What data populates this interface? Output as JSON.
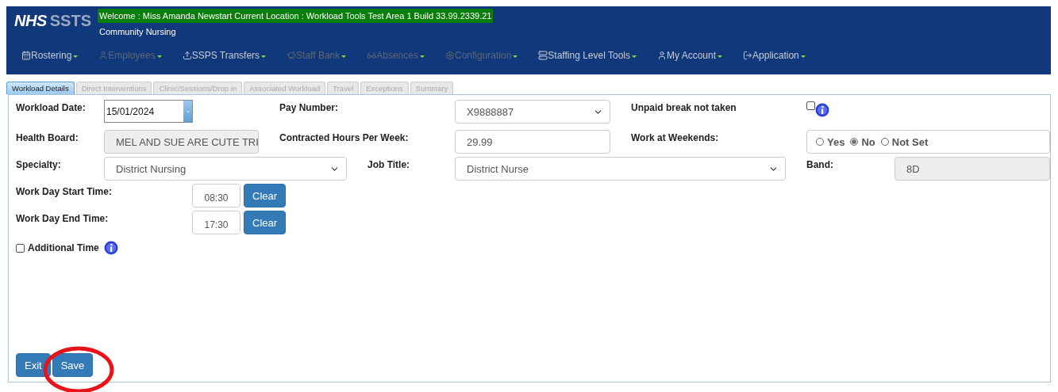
{
  "header": {
    "logo_left": "NHS",
    "logo_right": "SSTS",
    "welcome": "Welcome : Miss Amanda Newstart Current Location : Workload Tools Test Area 1 Build 33.99.2339.21",
    "subtitle": "Community Nursing"
  },
  "menu": [
    {
      "label": "Rostering",
      "disabled": false
    },
    {
      "label": "Employees",
      "disabled": true
    },
    {
      "label": "SSPS Transfers",
      "disabled": false
    },
    {
      "label": "Staff Bank",
      "disabled": true
    },
    {
      "label": "Absences",
      "disabled": true
    },
    {
      "label": "Configuration",
      "disabled": true
    },
    {
      "label": "Staffing Level Tools",
      "disabled": false
    },
    {
      "label": "My Account",
      "disabled": false
    },
    {
      "label": "Application",
      "disabled": false
    }
  ],
  "tabs": [
    {
      "label": "Workload Details",
      "selected": true
    },
    {
      "label": "Direct Interventions",
      "selected": false
    },
    {
      "label": "Clinic/Sessions/Drop in",
      "selected": false
    },
    {
      "label": "Associated Workload",
      "selected": false
    },
    {
      "label": "Travel",
      "selected": false
    },
    {
      "label": "Exceptions",
      "selected": false
    },
    {
      "label": "Summary",
      "selected": false
    }
  ],
  "form": {
    "workload_date": {
      "label": "Workload Date:",
      "value": "15/01/2024"
    },
    "pay_number": {
      "label": "Pay Number:",
      "value": "X9888887"
    },
    "unpaid_break": {
      "label": "Unpaid break not taken",
      "checked": false
    },
    "health_board": {
      "label": "Health Board:",
      "value": "MEL AND SUE ARE CUTE TRI"
    },
    "contracted_hours": {
      "label": "Contracted Hours Per Week:",
      "value": "29.99"
    },
    "weekends": {
      "label": "Work at Weekends:",
      "options": [
        {
          "label": "Yes",
          "selected": false
        },
        {
          "label": "No",
          "selected": true
        },
        {
          "label": "Not Set",
          "selected": false
        }
      ]
    },
    "specialty": {
      "label": "Specialty:",
      "value": "District Nursing"
    },
    "job_title": {
      "label": "Job Title:",
      "value": "District Nurse"
    },
    "band": {
      "label": "Band:",
      "value": "8D"
    },
    "start_time": {
      "label": "Work Day Start Time:",
      "value": "08:30",
      "button": "Clear"
    },
    "end_time": {
      "label": "Work Day End Time:",
      "value": "17:30",
      "button": "Clear"
    },
    "additional_time": {
      "label": "Additional Time",
      "checked": false
    }
  },
  "buttons": [
    "Exit",
    "Save"
  ]
}
